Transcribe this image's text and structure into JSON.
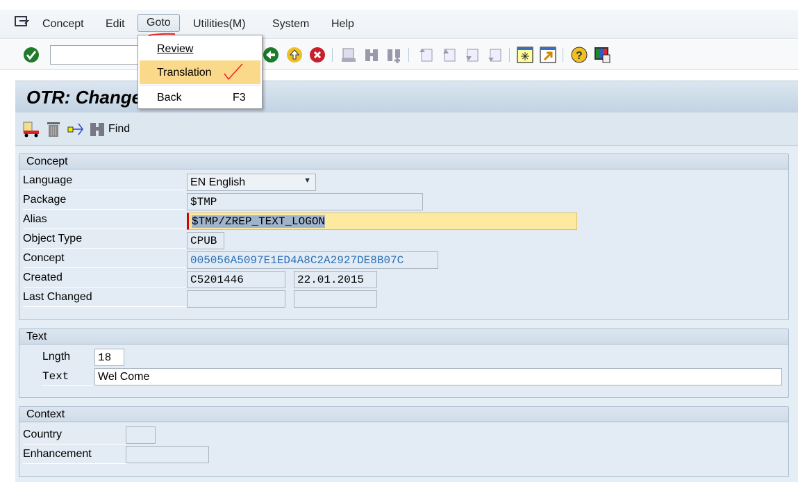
{
  "menubar": {
    "items": [
      "Concept",
      "Edit",
      "Goto",
      "Utilities(M)",
      "System",
      "Help"
    ]
  },
  "goto_menu": {
    "items": [
      {
        "label": "Review",
        "shortcut": ""
      },
      {
        "label": "Translation",
        "shortcut": ""
      },
      {
        "label": "Back",
        "shortcut": "F3"
      }
    ]
  },
  "title": "OTR: Change",
  "app_toolbar": {
    "find_label": "Find"
  },
  "concept_group": {
    "header": "Concept",
    "language_label": "Language",
    "language_value": "EN English",
    "package_label": "Package",
    "package_value": "$TMP",
    "alias_label": "Alias",
    "alias_value": "$TMP/ZREP_TEXT_LOGON",
    "object_type_label": "Object Type",
    "object_type_value": "CPUB",
    "concept_label": "Concept",
    "concept_value": "005056A5097E1ED4A8C2A2927DE8B07C",
    "created_label": "Created",
    "created_by": "C5201446",
    "created_on": "22.01.2015",
    "last_changed_label": "Last Changed",
    "last_changed_by": "",
    "last_changed_on": ""
  },
  "text_group": {
    "header": "Text",
    "length_label": "Lngth",
    "length_value": "18",
    "text_label": "Text",
    "text_value": "Wel Come"
  },
  "context_group": {
    "header": "Context",
    "country_label": "Country",
    "country_value": "",
    "enhancement_label": "Enhancement",
    "enhancement_value": ""
  },
  "colors": {
    "highlight": "#fbd98a",
    "alias_bg": "#fdeaa0",
    "concept_text": "#2a6fb5"
  }
}
